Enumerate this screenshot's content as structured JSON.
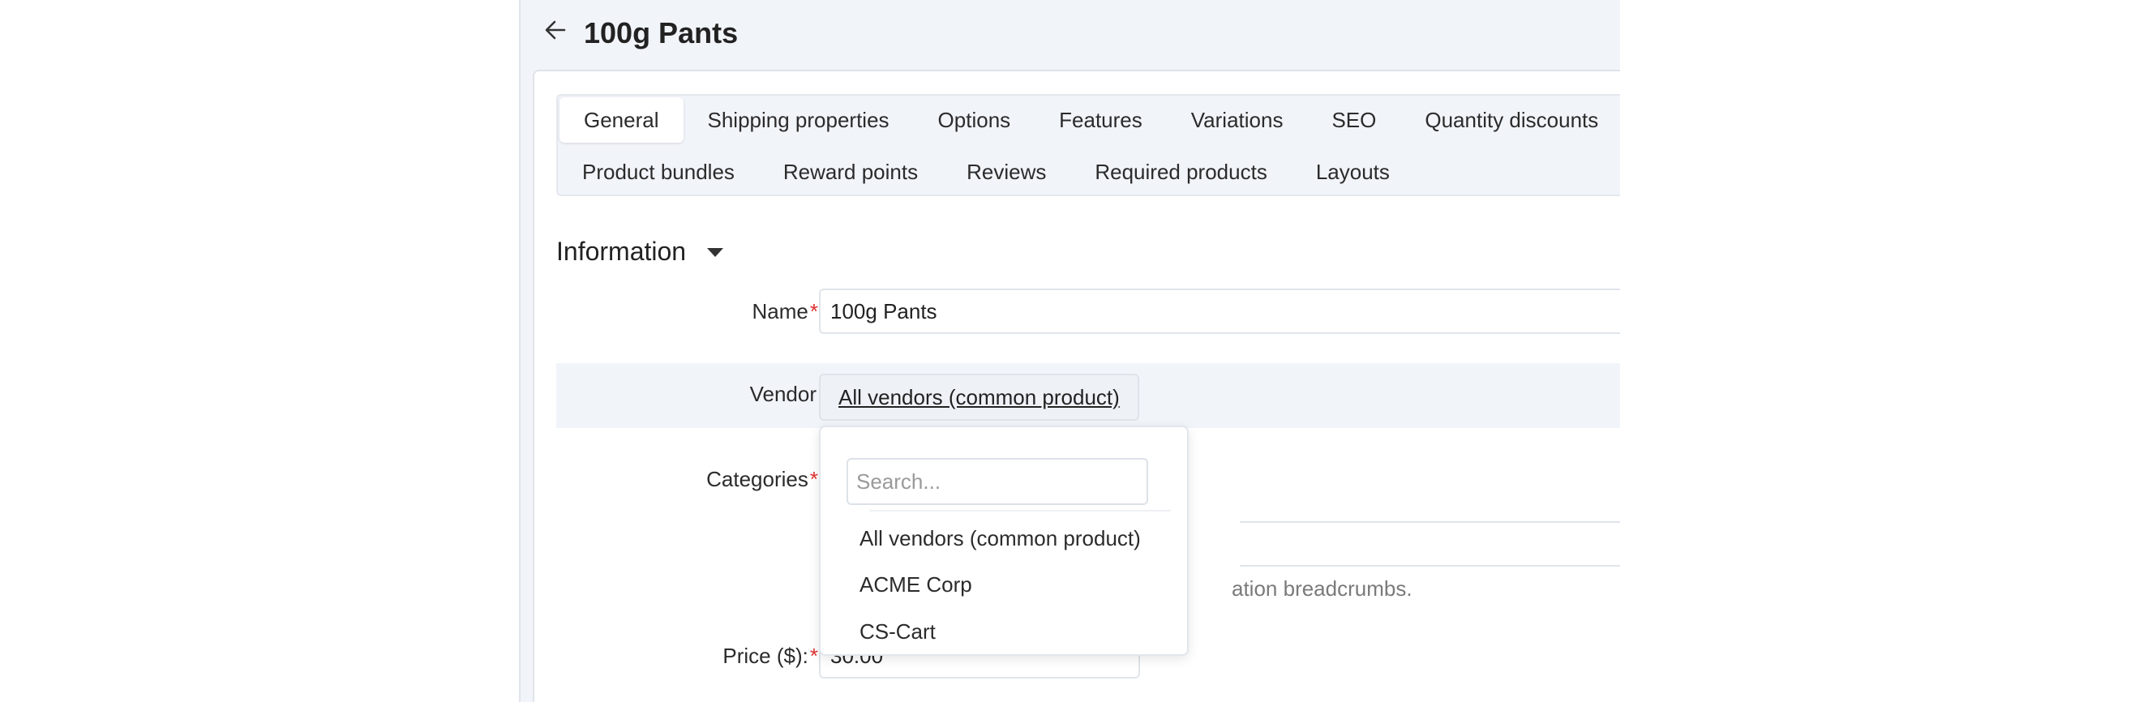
{
  "header": {
    "title": "100g Pants"
  },
  "tabs": {
    "row1": [
      "General",
      "Shipping properties",
      "Options",
      "Features",
      "Variations",
      "SEO",
      "Quantity discounts"
    ],
    "row2": [
      "Product bundles",
      "Reward points",
      "Reviews",
      "Required products",
      "Layouts"
    ],
    "active": "General"
  },
  "section": {
    "title": "Information"
  },
  "form": {
    "name_label": "Name",
    "name_value": "100g Pants",
    "vendor_label": "Vendor",
    "vendor_value": "All vendors (common product)",
    "categories_label": "Categories",
    "categories_hint": "ation breadcrumbs.",
    "price_label": "Price ($):",
    "price_value": "30.00",
    "required_mark": "*"
  },
  "vendor_dropdown": {
    "search_placeholder": "Search...",
    "options": [
      "All vendors (common product)",
      "ACME Corp",
      "CS-Cart"
    ]
  },
  "colors": {
    "accent_required": "#e0302f",
    "panel_bg": "#f1f4f9"
  },
  "icons": {
    "back": "arrow-left-icon",
    "collapse": "caret-down-icon"
  }
}
